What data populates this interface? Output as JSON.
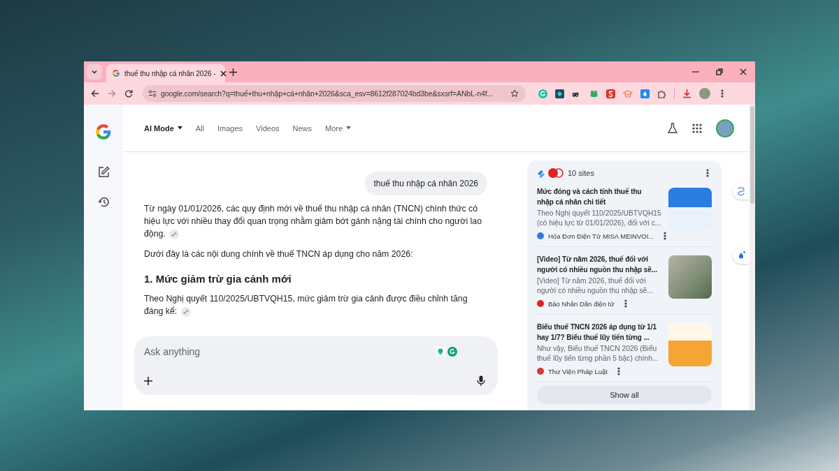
{
  "browser": {
    "tab": {
      "title": "thuế thu nhập cá nhân 2026 -",
      "selected": true
    },
    "address": "google.com/search?q=thuế+thu+nhập+cá+nhân+2026&sca_esv=8612f287024bd3be&sxsrf=ANbL-n4f..."
  },
  "nav_tabs": [
    {
      "label": "AI Mode",
      "selected": true,
      "dropdown": true
    },
    {
      "label": "All",
      "selected": false,
      "dropdown": false
    },
    {
      "label": "Images",
      "selected": false,
      "dropdown": false
    },
    {
      "label": "Videos",
      "selected": false,
      "dropdown": false
    },
    {
      "label": "News",
      "selected": false,
      "dropdown": false
    },
    {
      "label": "More",
      "selected": false,
      "dropdown": true
    }
  ],
  "conversation": {
    "query": "thuế thu nhập cá nhân 2026",
    "blocks": [
      {
        "kind": "paragraph",
        "text": "Từ ngày 01/01/2026, các quy định mới về thuế thu nhập cá nhân (TNCN) chính thức có hiệu lực với nhiều thay đổi quan trọng nhằm giảm bớt gánh nặng tài chính cho người lao động.",
        "citation": true
      },
      {
        "kind": "paragraph",
        "text": "Dưới đây là các nội dung chính về thuế TNCN áp dụng cho năm 2026:",
        "citation": false
      },
      {
        "kind": "heading",
        "text": "1. Mức giảm trừ gia cảnh mới",
        "citation": false
      },
      {
        "kind": "paragraph",
        "text": "Theo Nghị quyết 110/2025/UBTVQH15, mức giảm trừ gia cảnh được điều chỉnh tăng đáng kể:",
        "citation": true
      }
    ]
  },
  "prompt": {
    "placeholder": "Ask anything"
  },
  "sources": {
    "count": "10 sites",
    "items": [
      {
        "title_lines": [
          "Mức đóng và cách tính thuế thu",
          "nhập cá nhân chi tiết"
        ],
        "snippet_lines": [
          "Theo Nghị quyết 110/2025/UBTVQH15",
          "(có hiệu lực từ 01/01/2026), đối với c..."
        ],
        "source": "Hóa Đơn Điện Tử MISA MEINVOI...",
        "color": "#2f7de1"
      },
      {
        "title_lines": [
          "[Video] Từ năm 2026, thuế đối với",
          "người có nhiều nguồn thu nhập sẽ..."
        ],
        "snippet_lines": [
          "[Video] Từ năm 2026, thuế đối với",
          "người có nhiều nguồn thu nhập sẽ..."
        ],
        "source": "Báo Nhân Dân điện tử",
        "color": "#e02424"
      },
      {
        "title_lines": [
          "Biểu thuế TNCN 2026 áp dụng từ 1/1",
          "hay 1/7? Biểu thuế lũy tiến từng ..."
        ],
        "snippet_lines": [
          "Như vậy, Biểu thuế TNCN 2026 (Biểu",
          "thuế lũy tiến từng phần 5 bậc) chính..."
        ],
        "source": "Thư Viện Pháp Luật",
        "color": "#d93636"
      }
    ],
    "show_all": "Show all"
  }
}
